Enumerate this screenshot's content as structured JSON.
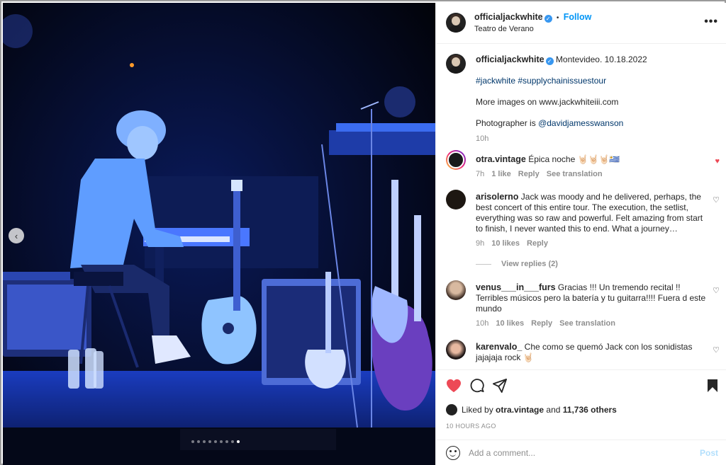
{
  "header": {
    "username": "officialjackwhite",
    "follow_label": "Follow",
    "location": "Teatro de Verano",
    "separator": "•"
  },
  "caption": {
    "username": "officialjackwhite",
    "text": "Montevideo. 10.18.2022",
    "hashtags": "#jackwhite #supplychainissuestour",
    "line2": "More images on www.jackwhiteiii.com",
    "line3_prefix": "Photographer is ",
    "line3_handle": "@davidjamesswanson",
    "time": "10h"
  },
  "comments": [
    {
      "username": "otra.vintage",
      "text": "Épica noche 🤘🏻🤘🏻🤘🏻🇺🇾",
      "time": "7h",
      "likes": "1 like",
      "reply": "Reply",
      "translate": "See translation",
      "liked": true
    },
    {
      "username": "arisolerno",
      "text": "Jack was moody and he delivered, perhaps, the best concert of this entire tour. The execution, the setlist, everything was so raw and powerful. Felt amazing from start to finish, I never wanted this to end. What a journey…",
      "time": "9h",
      "likes": "10 likes",
      "reply": "Reply",
      "view_replies": "View replies (2)",
      "liked": false
    },
    {
      "username": "venus___in___furs",
      "text": "Gracias !!! Un tremendo recital !! Terribles músicos pero la batería y tu guitarra!!!! Fuera d este mundo",
      "time": "10h",
      "likes": "10 likes",
      "reply": "Reply",
      "translate": "See translation",
      "liked": false
    },
    {
      "username": "karenvalo_",
      "text": "Che como se quemó Jack con los sonidistas jajajaja rock 🤘🏻",
      "liked": false
    }
  ],
  "actions": {
    "liked_by_prefix": "Liked by ",
    "liked_by_user": "otra.vintage",
    "liked_by_and": " and ",
    "liked_by_count": "11,736 others",
    "time_ago": "10 HOURS AGO"
  },
  "add_comment": {
    "placeholder": "Add a comment...",
    "post_label": "Post"
  },
  "carousel": {
    "total": 9,
    "active_index": 8
  },
  "colors": {
    "accent": "#0095f6",
    "like": "#ed4956",
    "link": "#00376b"
  }
}
